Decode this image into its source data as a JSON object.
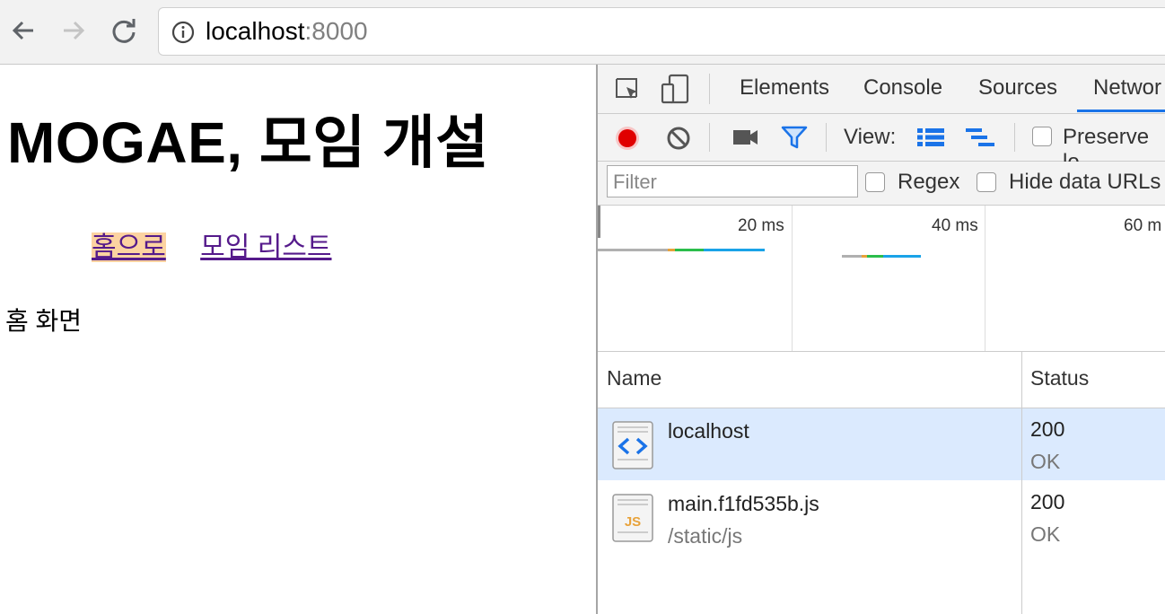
{
  "browser": {
    "url_host": "localhost",
    "url_port": ":8000"
  },
  "page": {
    "title": "MOGAE, 모임 개설",
    "nav": [
      {
        "label": "홈으로",
        "active": true
      },
      {
        "label": "모임 리스트",
        "active": false
      }
    ],
    "body_text": "홈 화면"
  },
  "devtools": {
    "tabs": [
      "Elements",
      "Console",
      "Sources",
      "Networ"
    ],
    "active_tab": "Networ",
    "toolbar": {
      "view_label": "View:",
      "preserve_label": "Preserve lo"
    },
    "filter": {
      "placeholder": "Filter",
      "regex_label": "Regex",
      "hide_data_urls_label": "Hide data URLs"
    },
    "overview_ticks": [
      "20 ms",
      "40 ms",
      "60 m"
    ],
    "columns": [
      "Name",
      "Status"
    ],
    "requests": [
      {
        "name": "localhost",
        "path": "",
        "status": "200",
        "status_text": "OK",
        "type": "document",
        "selected": true
      },
      {
        "name": "main.f1fd535b.js",
        "path": "/static/js",
        "status": "200",
        "status_text": "OK",
        "type": "script",
        "selected": false
      }
    ],
    "colors": {
      "record": "#e00000",
      "accent": "#1a73e8",
      "selected_row": "#dbeafe"
    }
  }
}
